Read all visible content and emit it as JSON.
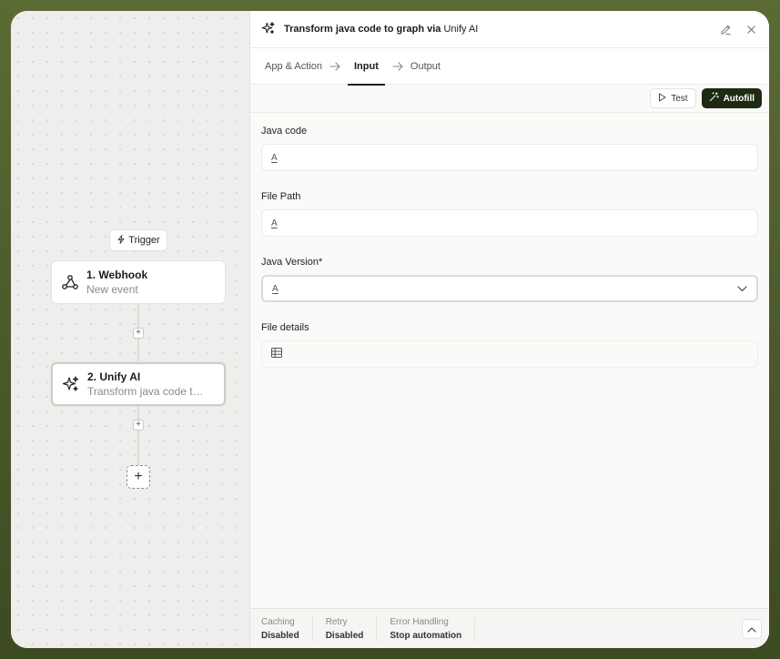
{
  "canvas": {
    "trigger_label": "Trigger",
    "nodes": [
      {
        "title": "1. Webhook",
        "subtitle": "New event"
      },
      {
        "title": "2. Unify AI",
        "subtitle": "Transform java code to..."
      }
    ],
    "plus": "+"
  },
  "panel": {
    "title": "Transform java code to graph via",
    "app_name": "Unify AI",
    "tabs": [
      "App & Action",
      "Input",
      "Output"
    ],
    "test_label": "Test",
    "autofill_label": "Autofill",
    "fields": [
      {
        "label": "Java code",
        "icon": "text-icon",
        "value": ""
      },
      {
        "label": "File Path",
        "icon": "text-icon",
        "value": ""
      },
      {
        "label": "Java Version*",
        "icon": "text-icon",
        "value": ""
      },
      {
        "label": "File details",
        "icon": "table-icon",
        "value": ""
      }
    ],
    "text_icon_glyph": "A",
    "footer": [
      {
        "label": "Caching",
        "value": "Disabled"
      },
      {
        "label": "Retry",
        "value": "Disabled"
      },
      {
        "label": "Error Handling",
        "value": "Stop automation"
      }
    ]
  },
  "colors": {
    "accent_dark": "#1e2a12",
    "outer_border": "#4a5a2a"
  }
}
